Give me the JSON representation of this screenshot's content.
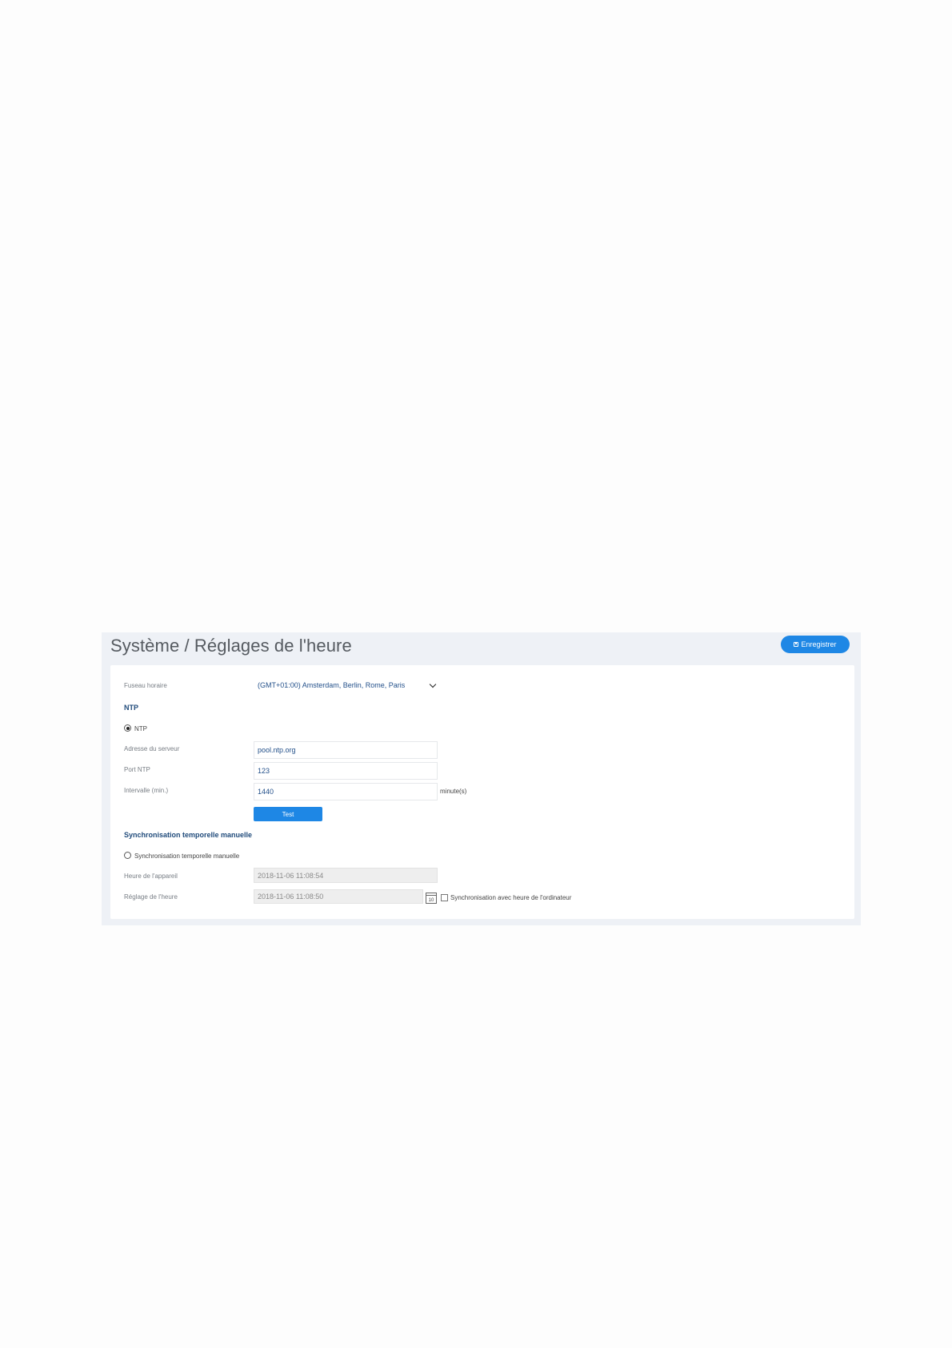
{
  "header": {
    "title": "Système / Réglages de l'heure",
    "save_label": "Enregistrer"
  },
  "timezone": {
    "label": "Fuseau horaire",
    "selected": "(GMT+01:00) Amsterdam, Berlin, Rome, Paris"
  },
  "ntp": {
    "section_title": "NTP",
    "radio_label": "NTP",
    "radio_checked": true,
    "server_label": "Adresse du serveur",
    "server_value": "pool.ntp.org",
    "port_label": "Port NTP",
    "port_value": "123",
    "interval_label": "Intervalle (min.)",
    "interval_value": "1440",
    "interval_suffix": "minute(s)",
    "test_label": "Test"
  },
  "manual": {
    "section_title": "Synchronisation temporelle manuelle",
    "radio_label": "Synchronisation temporelle manuelle",
    "radio_checked": false,
    "device_time_label": "Heure de l'appareil",
    "device_time_value": "2018-11-06 11:08:54",
    "set_time_label": "Réglage de l'heure",
    "set_time_value": "2018-11-06 11:08:50",
    "calendar_day": "10",
    "sync_pc_label": "Synchronisation avec heure de l'ordinateur"
  },
  "colors": {
    "accent": "#1e87e5",
    "page_background": "#eef1f6",
    "section_title": "#1f4a7a"
  }
}
